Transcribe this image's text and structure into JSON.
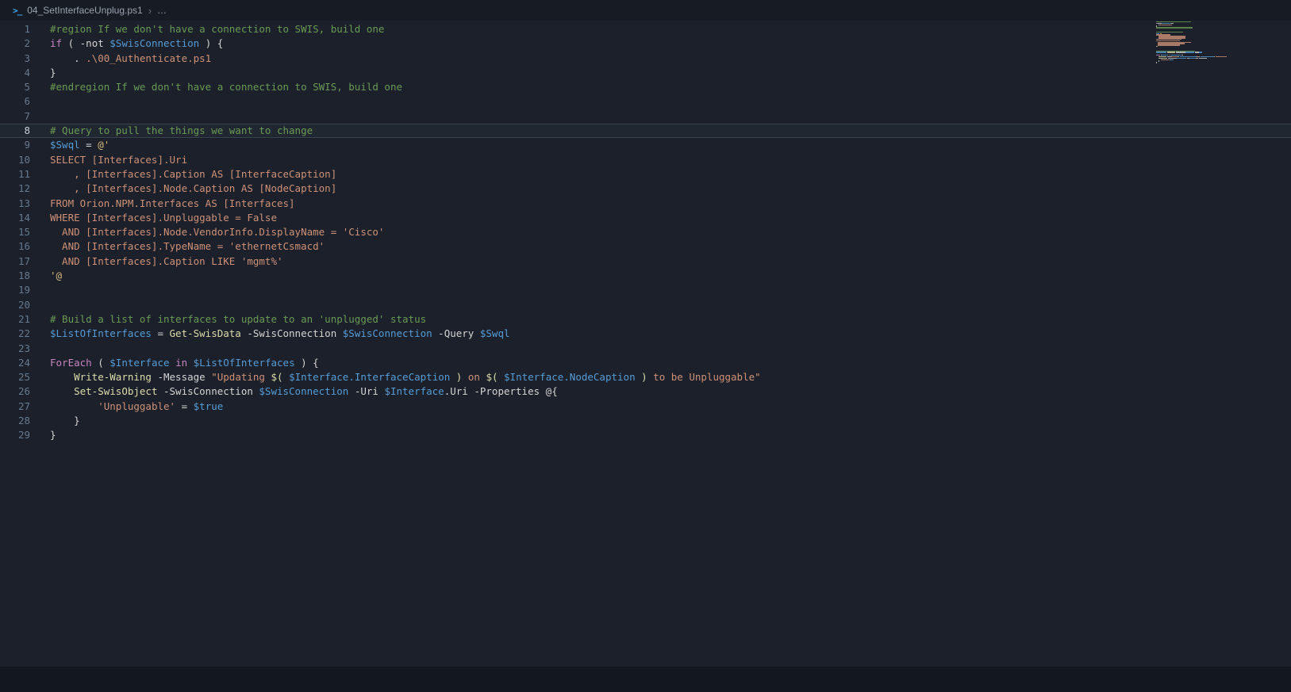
{
  "breadcrumb": {
    "icon_glyph": ">_",
    "file": "04_SetInterfaceUnplug.ps1",
    "separator": "›",
    "more": "…"
  },
  "colors": {
    "comment": "#6A9955",
    "keyword": "#C586C0",
    "variable": "#569CD6",
    "function": "#DCDCAA",
    "string": "#CE9178",
    "plain": "#D4D4D4",
    "delim": "#DCDCAA",
    "heredelim": "#D7BA7D"
  },
  "editor": {
    "language": "powershell",
    "current_line": 8,
    "lines": [
      {
        "tokens": [
          {
            "t": "#region If we don't have a connection to SWIS, build one",
            "c": "comment"
          }
        ]
      },
      {
        "tokens": [
          {
            "t": "if",
            "c": "keyword"
          },
          {
            "t": " ( -not ",
            "c": "plain"
          },
          {
            "t": "$SwisConnection",
            "c": "variable"
          },
          {
            "t": " ) {",
            "c": "plain"
          }
        ]
      },
      {
        "tokens": [
          {
            "t": "    . ",
            "c": "plain"
          },
          {
            "t": ".\\00_Authenticate.ps1",
            "c": "string"
          }
        ]
      },
      {
        "tokens": [
          {
            "t": "}",
            "c": "plain"
          }
        ]
      },
      {
        "tokens": [
          {
            "t": "#endregion If we don't have a connection to SWIS, build one",
            "c": "comment"
          }
        ]
      },
      {
        "tokens": []
      },
      {
        "tokens": []
      },
      {
        "tokens": [
          {
            "t": "# Query to pull the things we want to change",
            "c": "comment"
          }
        ]
      },
      {
        "tokens": [
          {
            "t": "$Swql",
            "c": "variable"
          },
          {
            "t": " = ",
            "c": "plain"
          },
          {
            "t": "@'",
            "c": "heredelim"
          }
        ]
      },
      {
        "tokens": [
          {
            "t": "SELECT [Interfaces].Uri",
            "c": "string"
          }
        ]
      },
      {
        "tokens": [
          {
            "t": "    , [Interfaces].Caption AS [InterfaceCaption]",
            "c": "string"
          }
        ]
      },
      {
        "tokens": [
          {
            "t": "    , [Interfaces].Node.Caption AS [NodeCaption]",
            "c": "string"
          }
        ]
      },
      {
        "tokens": [
          {
            "t": "FROM Orion.NPM.Interfaces AS [Interfaces]",
            "c": "string"
          }
        ]
      },
      {
        "tokens": [
          {
            "t": "WHERE [Interfaces].Unpluggable = False",
            "c": "string"
          }
        ]
      },
      {
        "tokens": [
          {
            "t": "  AND [Interfaces].Node.VendorInfo.DisplayName = 'Cisco'",
            "c": "string"
          }
        ]
      },
      {
        "tokens": [
          {
            "t": "  AND [Interfaces].TypeName = 'ethernetCsmacd'",
            "c": "string"
          }
        ]
      },
      {
        "tokens": [
          {
            "t": "  AND [Interfaces].Caption LIKE 'mgmt%'",
            "c": "string"
          }
        ]
      },
      {
        "tokens": [
          {
            "t": "'@",
            "c": "heredelim"
          }
        ]
      },
      {
        "tokens": []
      },
      {
        "tokens": []
      },
      {
        "tokens": [
          {
            "t": "# Build a list of interfaces to update to an 'unplugged' status",
            "c": "comment"
          }
        ]
      },
      {
        "tokens": [
          {
            "t": "$ListOfInterfaces",
            "c": "variable"
          },
          {
            "t": " = ",
            "c": "plain"
          },
          {
            "t": "Get-SwisData",
            "c": "function"
          },
          {
            "t": " -SwisConnection ",
            "c": "plain"
          },
          {
            "t": "$SwisConnection",
            "c": "variable"
          },
          {
            "t": " -Query ",
            "c": "plain"
          },
          {
            "t": "$Swql",
            "c": "variable"
          }
        ]
      },
      {
        "tokens": []
      },
      {
        "tokens": [
          {
            "t": "ForEach",
            "c": "keyword"
          },
          {
            "t": " ( ",
            "c": "plain"
          },
          {
            "t": "$Interface",
            "c": "variable"
          },
          {
            "t": " ",
            "c": "plain"
          },
          {
            "t": "in",
            "c": "keyword"
          },
          {
            "t": " ",
            "c": "plain"
          },
          {
            "t": "$ListOfInterfaces",
            "c": "variable"
          },
          {
            "t": " ) {",
            "c": "plain"
          }
        ]
      },
      {
        "tokens": [
          {
            "t": "    ",
            "c": "plain"
          },
          {
            "t": "Write-Warning",
            "c": "function"
          },
          {
            "t": " -Message ",
            "c": "plain"
          },
          {
            "t": "\"Updating ",
            "c": "string"
          },
          {
            "t": "$(",
            "c": "delim"
          },
          {
            "t": " $Interface.InterfaceCaption ",
            "c": "variable"
          },
          {
            "t": ")",
            "c": "delim"
          },
          {
            "t": " on ",
            "c": "string"
          },
          {
            "t": "$(",
            "c": "delim"
          },
          {
            "t": " $Interface.NodeCaption ",
            "c": "variable"
          },
          {
            "t": ")",
            "c": "delim"
          },
          {
            "t": " to be Unpluggable\"",
            "c": "string"
          }
        ]
      },
      {
        "tokens": [
          {
            "t": "    ",
            "c": "plain"
          },
          {
            "t": "Set-SwisObject",
            "c": "function"
          },
          {
            "t": " -SwisConnection ",
            "c": "plain"
          },
          {
            "t": "$SwisConnection",
            "c": "variable"
          },
          {
            "t": " -Uri ",
            "c": "plain"
          },
          {
            "t": "$Interface",
            "c": "variable"
          },
          {
            "t": ".Uri",
            "c": "plain"
          },
          {
            "t": " -Properties ",
            "c": "plain"
          },
          {
            "t": "@{",
            "c": "plain"
          }
        ]
      },
      {
        "tokens": [
          {
            "t": "        ",
            "c": "plain"
          },
          {
            "t": "'Unpluggable'",
            "c": "string"
          },
          {
            "t": " = ",
            "c": "plain"
          },
          {
            "t": "$true",
            "c": "variable"
          }
        ]
      },
      {
        "tokens": [
          {
            "t": "    }",
            "c": "plain"
          }
        ]
      },
      {
        "tokens": [
          {
            "t": "}",
            "c": "plain"
          }
        ]
      }
    ]
  }
}
